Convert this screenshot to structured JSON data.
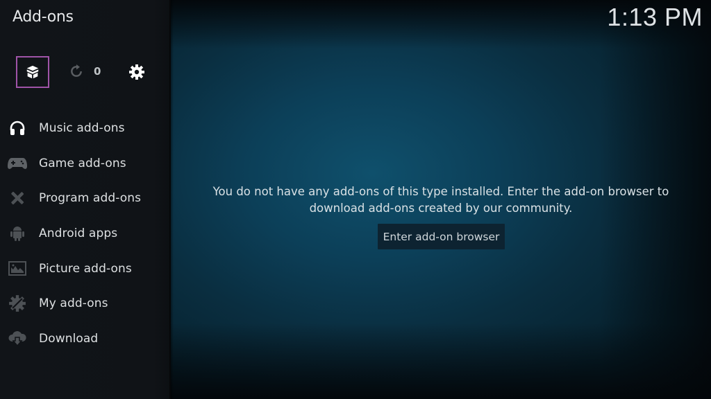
{
  "header": {
    "title": "Add-ons",
    "clock": "1:13 PM"
  },
  "toolbar": {
    "addon_browser_icon": "open-box-icon",
    "updates_icon": "refresh-icon",
    "updates_count": "0",
    "settings_icon": "gear-icon",
    "focus_color": "#a054a8"
  },
  "sidebar": {
    "items": [
      {
        "label": "Music add-ons",
        "icon": "headphones-icon"
      },
      {
        "label": "Game add-ons",
        "icon": "gamepad-icon"
      },
      {
        "label": "Program add-ons",
        "icon": "tools-icon"
      },
      {
        "label": "Android apps",
        "icon": "android-icon"
      },
      {
        "label": "Picture add-ons",
        "icon": "picture-icon"
      },
      {
        "label": "My add-ons",
        "icon": "gear-wrench-icon"
      },
      {
        "label": "Download",
        "icon": "cloud-download-icon"
      }
    ]
  },
  "main": {
    "message_line1": "You do not have any add-ons of this type installed. Enter the add-on browser to",
    "message_line2": "download add-ons created by our community.",
    "browser_button": "Enter add-on browser"
  }
}
